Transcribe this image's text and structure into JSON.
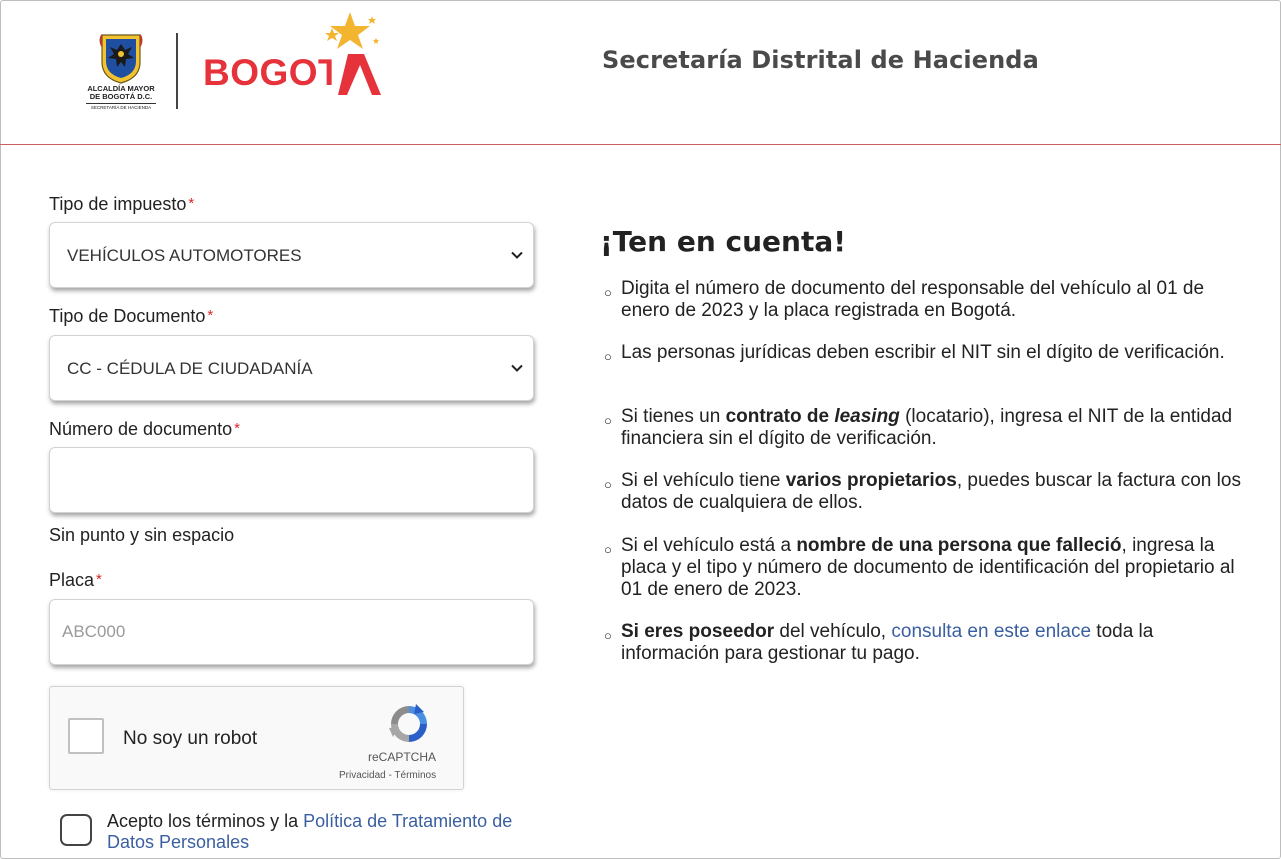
{
  "header": {
    "crest_caption_line1": "ALCALDÍA MAYOR",
    "crest_caption_line2": "DE BOGOTÁ D.C.",
    "crest_caption_line3": "SECRETARÍA DE HACIENDA",
    "brand_logo_text": "BOGOTA",
    "title": "Secretaría Distrital de Hacienda",
    "divider_color": "#c9605e",
    "brand_color": "#e5323b",
    "star_color": "#f3b530"
  },
  "form": {
    "tax_type": {
      "label": "Tipo de impuesto",
      "required_mark": "*",
      "value": "VEHÍCULOS AUTOMOTORES"
    },
    "document_type": {
      "label": "Tipo de Documento",
      "required_mark": "*",
      "value": "CC - CÉDULA DE CIUDADANÍA"
    },
    "document_number": {
      "label": "Número de documento",
      "required_mark": "*",
      "value": "",
      "hint": "Sin punto y sin espacio"
    },
    "plate": {
      "label": "Placa",
      "required_mark": "*",
      "placeholder": "ABC000",
      "value": ""
    },
    "captcha": {
      "label": "No soy un robot",
      "brand": "reCAPTCHA",
      "links": "Privacidad - Términos",
      "checked": false
    },
    "accept": {
      "text_before": "Acepto los términos y la ",
      "link": "Política de Tratamiento de Datos Personales",
      "checked": false
    }
  },
  "tips": {
    "title": "¡Ten en cuenta!",
    "bullet_glyph": "○",
    "link_color": "#3a5fa0",
    "items": [
      {
        "text": "Digita el número de documento del responsable del vehículo al 01 de enero de 2023 y la placa registrada en Bogotá."
      },
      {
        "text": "Las personas jurídicas deben escribir el NIT sin el dígito de verificación."
      },
      {
        "pre": "Si tienes un ",
        "bold1": "contrato de ",
        "bolditalic": "leasing",
        "post": " (locatario), ingresa el NIT de la entidad financiera sin el dígito de verificación."
      },
      {
        "pre": "Si el vehículo tiene ",
        "bold": "varios propietarios",
        "post": ", puedes buscar la factura con los datos de cualquiera de ellos."
      },
      {
        "pre": "Si el vehículo está a ",
        "bold": "nombre de una persona que falleció",
        "post": ", ingresa la placa y el tipo y número de documento de identificación del propietario al 01 de enero de 2023."
      },
      {
        "bold": "Si eres poseedor",
        "mid": " del vehículo, ",
        "link": "consulta en este enlace",
        "post": " toda la información para gestionar tu pago."
      }
    ]
  }
}
